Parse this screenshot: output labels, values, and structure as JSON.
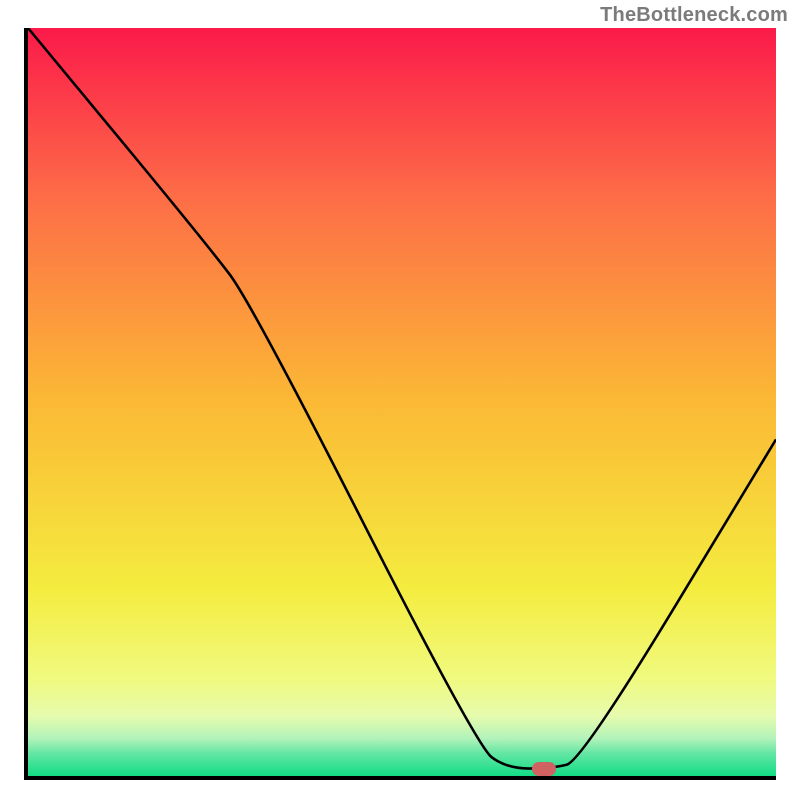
{
  "watermark": "TheBottleneck.com",
  "chart_data": {
    "type": "line",
    "title": "",
    "xlabel": "",
    "ylabel": "",
    "xlim": [
      0,
      100
    ],
    "ylim": [
      0,
      100
    ],
    "grid": false,
    "series": [
      {
        "name": "curve",
        "points": [
          {
            "x": 0,
            "y": 100
          },
          {
            "x": 24,
            "y": 71
          },
          {
            "x": 30,
            "y": 63
          },
          {
            "x": 60,
            "y": 4
          },
          {
            "x": 64,
            "y": 1
          },
          {
            "x": 70,
            "y": 1
          },
          {
            "x": 74,
            "y": 2
          },
          {
            "x": 100,
            "y": 45
          }
        ]
      }
    ],
    "marker": {
      "x": 69,
      "y": 1,
      "color": "#d06262"
    },
    "background_gradient_stops": [
      {
        "offset": 0,
        "color": "#fb1a4a"
      },
      {
        "offset": 23,
        "color": "#fd6e47"
      },
      {
        "offset": 50,
        "color": "#fbb935"
      },
      {
        "offset": 75,
        "color": "#f4ec3f"
      },
      {
        "offset": 87,
        "color": "#f0fa7f"
      },
      {
        "offset": 92,
        "color": "#e6fbae"
      },
      {
        "offset": 95,
        "color": "#b1f3ba"
      },
      {
        "offset": 97,
        "color": "#63e6a3"
      },
      {
        "offset": 100,
        "color": "#12dd85"
      }
    ]
  }
}
